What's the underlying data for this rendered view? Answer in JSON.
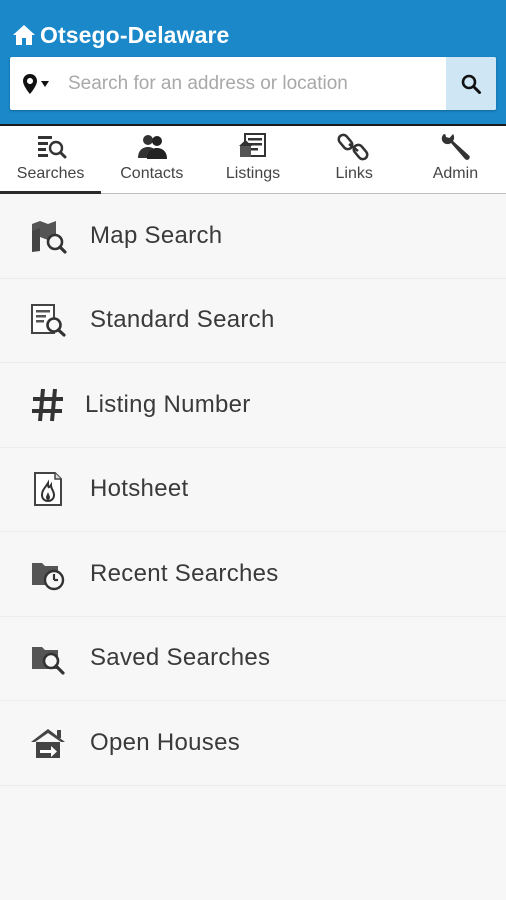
{
  "header": {
    "title": "Otsego-Delaware",
    "brand_color": "#1a88c9"
  },
  "search": {
    "placeholder": "Search for an address or location",
    "value": ""
  },
  "tabs": [
    {
      "label": "Searches",
      "icon": "searches-icon",
      "active": true
    },
    {
      "label": "Contacts",
      "icon": "contacts-icon",
      "active": false
    },
    {
      "label": "Listings",
      "icon": "listings-icon",
      "active": false
    },
    {
      "label": "Links",
      "icon": "links-icon",
      "active": false
    },
    {
      "label": "Admin",
      "icon": "admin-icon",
      "active": false
    }
  ],
  "menu": [
    {
      "label": "Map Search",
      "icon": "map-search-icon"
    },
    {
      "label": "Standard Search",
      "icon": "standard-search-icon"
    },
    {
      "label": "Listing Number",
      "icon": "hash-icon"
    },
    {
      "label": "Hotsheet",
      "icon": "hotsheet-icon"
    },
    {
      "label": "Recent Searches",
      "icon": "recent-searches-icon"
    },
    {
      "label": "Saved Searches",
      "icon": "saved-searches-icon"
    },
    {
      "label": "Open Houses",
      "icon": "open-houses-icon"
    }
  ]
}
